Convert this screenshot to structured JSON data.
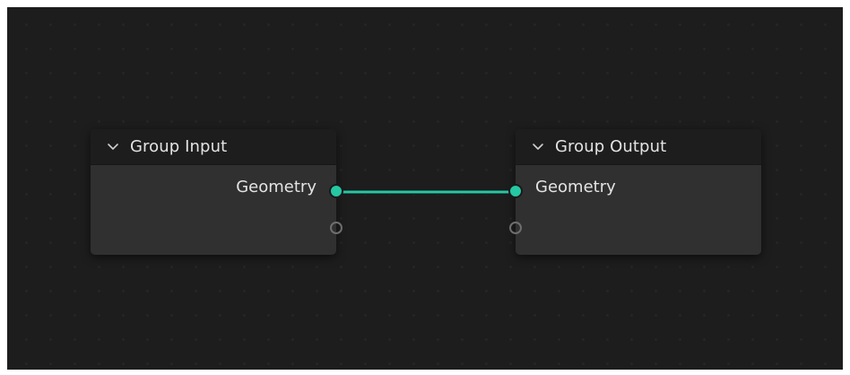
{
  "colors": {
    "background": "#1d1d1d",
    "node_body": "#303030",
    "node_header": "#1d1d1d",
    "geometry_socket": "#26c7a3",
    "link": "#26c7a3",
    "empty_socket_outline": "#6e6e6e",
    "text": "#e3e3e3"
  },
  "nodes": {
    "group_input": {
      "title": "Group Input",
      "outputs": [
        "Geometry"
      ],
      "icon": "chevron-down-icon"
    },
    "group_output": {
      "title": "Group Output",
      "inputs": [
        "Geometry"
      ],
      "icon": "chevron-down-icon"
    }
  },
  "link": {
    "from": "Group Input.Geometry",
    "to": "Group Output.Geometry"
  }
}
